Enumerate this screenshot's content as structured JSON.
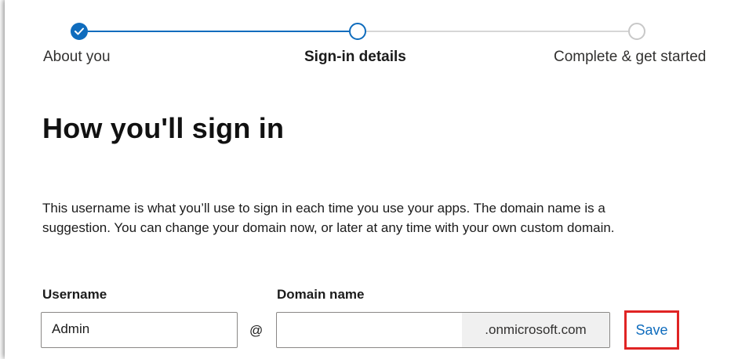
{
  "stepper": {
    "steps": [
      {
        "label": "About you",
        "state": "completed"
      },
      {
        "label": "Sign-in details",
        "state": "current"
      },
      {
        "label": "Complete & get started",
        "state": "upcoming"
      }
    ],
    "accent_color": "#0f6cbd",
    "inactive_color": "#c8c8c8"
  },
  "page": {
    "title": "How you'll sign in",
    "description": "This username is what you’ll use to sign in each time you use your apps. The domain name is a suggestion. You can change your domain now, or later at any time with your own custom domain."
  },
  "form": {
    "username_label": "Username",
    "username_value": "Admin",
    "at_symbol": "@",
    "domain_label": "Domain name",
    "domain_value": "",
    "domain_suffix": ".onmicrosoft.com",
    "save_label": "Save",
    "highlight_color": "#e02424"
  }
}
